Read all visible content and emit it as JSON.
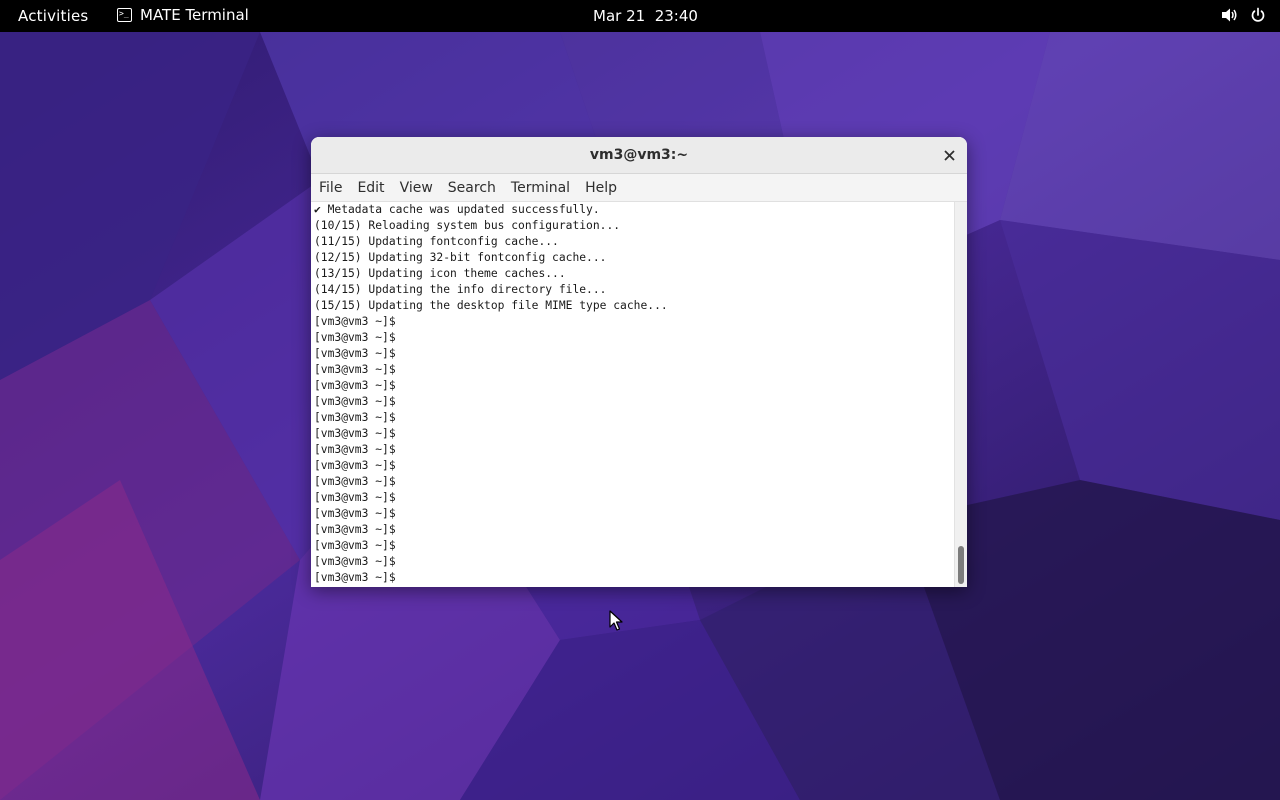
{
  "topbar": {
    "activities_label": "Activities",
    "app_name": "MATE Terminal",
    "clock": "Mar 21  23:40",
    "icons": [
      "terminal-icon",
      "volume-icon",
      "power-icon"
    ]
  },
  "window": {
    "title": "vm3@vm3:~",
    "menu": [
      "File",
      "Edit",
      "View",
      "Search",
      "Terminal",
      "Help"
    ]
  },
  "terminal": {
    "lines": [
      "✔ Metadata cache was updated successfully.",
      "(10/15) Reloading system bus configuration...",
      "(11/15) Updating fontconfig cache...",
      "(12/15) Updating 32-bit fontconfig cache...",
      "(13/15) Updating icon theme caches...",
      "(14/15) Updating the info directory file...",
      "(15/15) Updating the desktop file MIME type cache...",
      "[vm3@vm3 ~]$",
      "[vm3@vm3 ~]$",
      "[vm3@vm3 ~]$",
      "[vm3@vm3 ~]$",
      "[vm3@vm3 ~]$",
      "[vm3@vm3 ~]$",
      "[vm3@vm3 ~]$",
      "[vm3@vm3 ~]$",
      "[vm3@vm3 ~]$",
      "[vm3@vm3 ~]$",
      "[vm3@vm3 ~]$",
      "[vm3@vm3 ~]$",
      "[vm3@vm3 ~]$",
      "[vm3@vm3 ~]$",
      "[vm3@vm3 ~]$",
      "[vm3@vm3 ~]$",
      "[vm3@vm3 ~]$"
    ]
  },
  "colors": {
    "wallpaper_base": "#3d1f7a",
    "topbar_bg": "#000000",
    "window_bg": "#ffffff"
  }
}
